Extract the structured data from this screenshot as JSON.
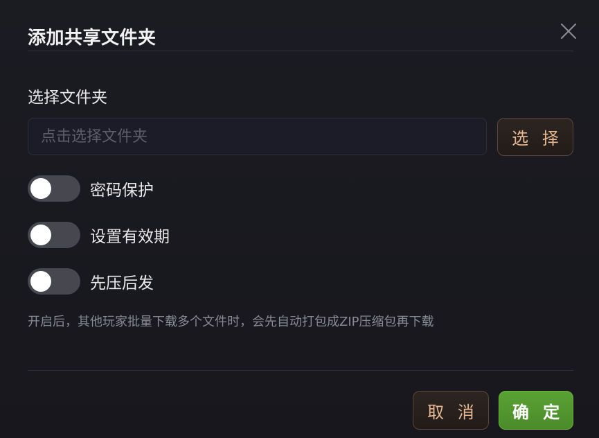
{
  "dialog": {
    "title": "添加共享文件夹",
    "close_icon": "close-icon"
  },
  "folder": {
    "label": "选择文件夹",
    "placeholder": "点击选择文件夹",
    "value": "",
    "select_button": "选 择"
  },
  "toggles": [
    {
      "label": "密码保护",
      "enabled": false
    },
    {
      "label": "设置有效期",
      "enabled": false
    },
    {
      "label": "先压后发",
      "enabled": false
    }
  ],
  "hint": "开启后，其他玩家批量下载多个文件时，会先自动打包成ZIP压缩包再下载",
  "footer": {
    "cancel_label": "取 消",
    "confirm_label": "确 定"
  },
  "colors": {
    "background": "#18181e",
    "accent_brown_text": "#e8b892",
    "confirm_green": "#5aa234",
    "toggle_off": "#474750"
  }
}
